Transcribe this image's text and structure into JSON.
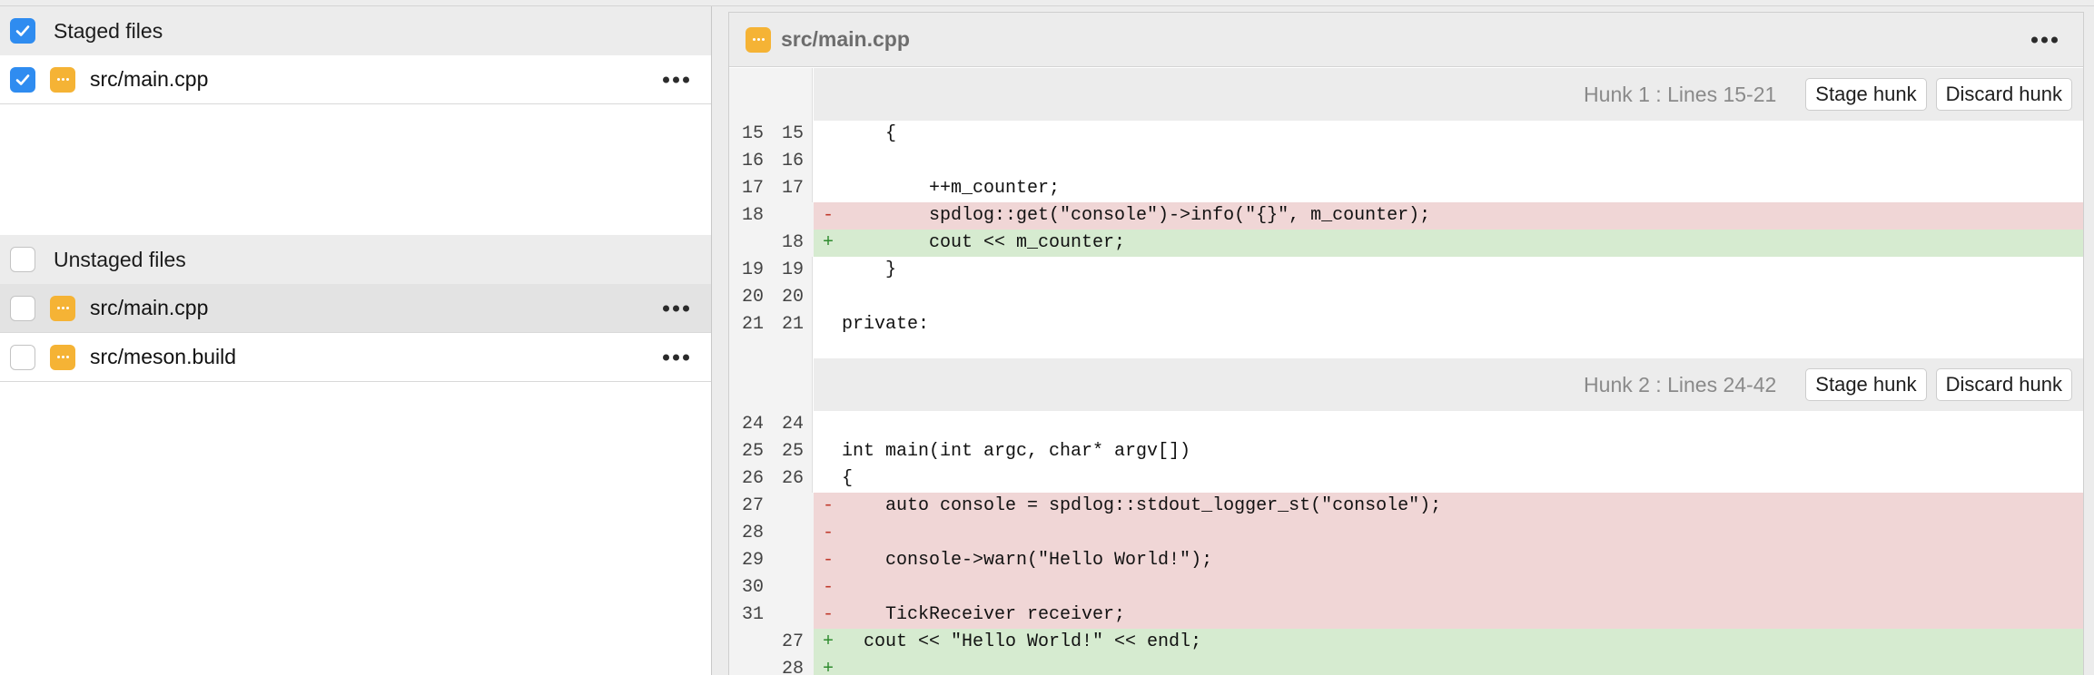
{
  "staged": {
    "header_label": "Staged files",
    "header_checked": true,
    "files": [
      {
        "name": "src/main.cpp",
        "checked": true
      }
    ]
  },
  "unstaged": {
    "header_label": "Unstaged files",
    "header_checked": false,
    "files": [
      {
        "name": "src/main.cpp",
        "checked": false,
        "selected": true
      },
      {
        "name": "src/meson.build",
        "checked": false,
        "selected": false
      }
    ]
  },
  "diff": {
    "file_title": "src/main.cpp",
    "stage_hunk_label": "Stage hunk",
    "discard_hunk_label": "Discard hunk",
    "hunks": [
      {
        "label": "Hunk 1 : Lines 15-21",
        "lines": [
          {
            "old": "15",
            "new": "15",
            "type": "ctx",
            "sign": "",
            "text": "    {"
          },
          {
            "old": "16",
            "new": "16",
            "type": "ctx",
            "sign": "",
            "text": ""
          },
          {
            "old": "17",
            "new": "17",
            "type": "ctx",
            "sign": "",
            "text": "        ++m_counter;"
          },
          {
            "old": "18",
            "new": "",
            "type": "del",
            "sign": "-",
            "text": "        spdlog::get(\"console\")->info(\"{}\", m_counter);"
          },
          {
            "old": "",
            "new": "18",
            "type": "add",
            "sign": "+",
            "text": "        cout << m_counter;"
          },
          {
            "old": "19",
            "new": "19",
            "type": "ctx",
            "sign": "",
            "text": "    }"
          },
          {
            "old": "20",
            "new": "20",
            "type": "ctx",
            "sign": "",
            "text": ""
          },
          {
            "old": "21",
            "new": "21",
            "type": "ctx",
            "sign": "",
            "text": "private:"
          }
        ]
      },
      {
        "label": "Hunk 2 : Lines 24-42",
        "lines": [
          {
            "old": "24",
            "new": "24",
            "type": "ctx",
            "sign": "",
            "text": ""
          },
          {
            "old": "25",
            "new": "25",
            "type": "ctx",
            "sign": "",
            "text": "int main(int argc, char* argv[])"
          },
          {
            "old": "26",
            "new": "26",
            "type": "ctx",
            "sign": "",
            "text": "{"
          },
          {
            "old": "27",
            "new": "",
            "type": "del",
            "sign": "-",
            "text": "    auto console = spdlog::stdout_logger_st(\"console\");"
          },
          {
            "old": "28",
            "new": "",
            "type": "del",
            "sign": "-",
            "text": ""
          },
          {
            "old": "29",
            "new": "",
            "type": "del",
            "sign": "-",
            "text": "    console->warn(\"Hello World!\");"
          },
          {
            "old": "30",
            "new": "",
            "type": "del",
            "sign": "-",
            "text": ""
          },
          {
            "old": "31",
            "new": "",
            "type": "del",
            "sign": "-",
            "text": "    TickReceiver receiver;"
          },
          {
            "old": "",
            "new": "27",
            "type": "add",
            "sign": "+",
            "text": "  cout << \"Hello World!\" << endl;"
          },
          {
            "old": "",
            "new": "28",
            "type": "add",
            "sign": "+",
            "text": ""
          }
        ]
      }
    ]
  }
}
